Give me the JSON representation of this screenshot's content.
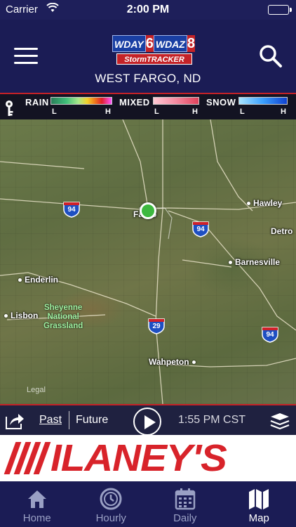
{
  "status_bar": {
    "carrier": "Carrier",
    "time": "2:00 PM"
  },
  "header": {
    "logo": {
      "station1": "WDAY",
      "num1": "6",
      "station2": "WDAZ",
      "num2": "8",
      "tracker": "StormTRACKER"
    },
    "location": "WEST FARGO, ND"
  },
  "legend": {
    "rain": {
      "label": "RAIN",
      "low": "L",
      "high": "H"
    },
    "mixed": {
      "label": "MIXED",
      "low": "L",
      "high": "H"
    },
    "snow": {
      "label": "SNOW",
      "low": "L",
      "high": "H"
    }
  },
  "map": {
    "cities": [
      {
        "name": "Hawley"
      },
      {
        "name": "Detro"
      },
      {
        "name": "Barnesville"
      },
      {
        "name": "Enderlin"
      },
      {
        "name": "Lisbon"
      },
      {
        "name": "Wahpeton"
      },
      {
        "name": "Fargo"
      }
    ],
    "grassland": [
      "Sheyenne",
      "National",
      "Grassland"
    ],
    "shields": [
      "94",
      "94",
      "94",
      "29"
    ],
    "legal": "Legal"
  },
  "playback": {
    "past": "Past",
    "future": "Future",
    "timestamp": "1:55 PM CST"
  },
  "ad": {
    "brand": "ILANEY'S"
  },
  "tabs": [
    {
      "label": "Home",
      "icon": "home-icon"
    },
    {
      "label": "Hourly",
      "icon": "clock-icon"
    },
    {
      "label": "Daily",
      "icon": "calendar-icon"
    },
    {
      "label": "Map",
      "icon": "map-icon"
    }
  ],
  "colors": {
    "header_bg": "#1b1c55",
    "accent_red": "#c42227",
    "marker_green": "#3db83f"
  }
}
